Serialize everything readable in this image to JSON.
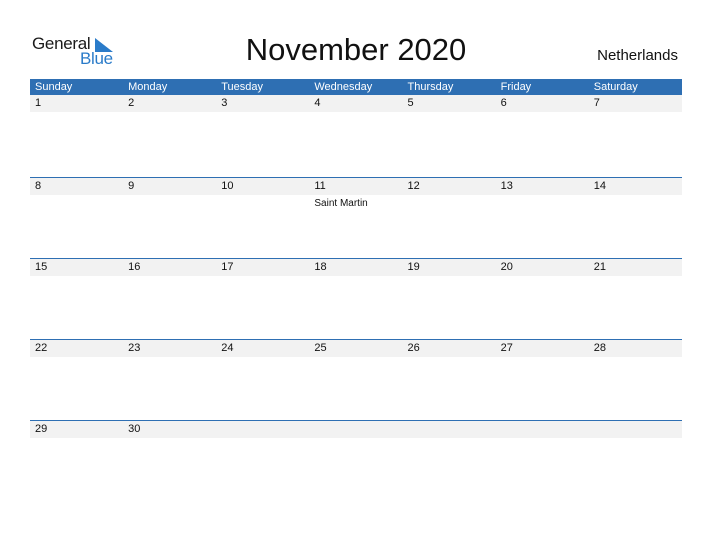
{
  "logo": {
    "line1": "General",
    "line2": "Blue"
  },
  "title": "November 2020",
  "country": "Netherlands",
  "colors": {
    "header_bg": "#2e6fb3",
    "date_strip": "#f2f2f2",
    "brand_blue": "#2a7bc9"
  },
  "weekdays": [
    "Sunday",
    "Monday",
    "Tuesday",
    "Wednesday",
    "Thursday",
    "Friday",
    "Saturday"
  ],
  "weeks": [
    {
      "days": [
        {
          "n": "1"
        },
        {
          "n": "2"
        },
        {
          "n": "3"
        },
        {
          "n": "4"
        },
        {
          "n": "5"
        },
        {
          "n": "6"
        },
        {
          "n": "7"
        }
      ]
    },
    {
      "days": [
        {
          "n": "8"
        },
        {
          "n": "9"
        },
        {
          "n": "10"
        },
        {
          "n": "11",
          "holiday": "Saint Martin"
        },
        {
          "n": "12"
        },
        {
          "n": "13"
        },
        {
          "n": "14"
        }
      ]
    },
    {
      "days": [
        {
          "n": "15"
        },
        {
          "n": "16"
        },
        {
          "n": "17"
        },
        {
          "n": "18"
        },
        {
          "n": "19"
        },
        {
          "n": "20"
        },
        {
          "n": "21"
        }
      ]
    },
    {
      "days": [
        {
          "n": "22"
        },
        {
          "n": "23"
        },
        {
          "n": "24"
        },
        {
          "n": "25"
        },
        {
          "n": "26"
        },
        {
          "n": "27"
        },
        {
          "n": "28"
        }
      ]
    },
    {
      "days": [
        {
          "n": "29"
        },
        {
          "n": "30"
        }
      ]
    }
  ]
}
